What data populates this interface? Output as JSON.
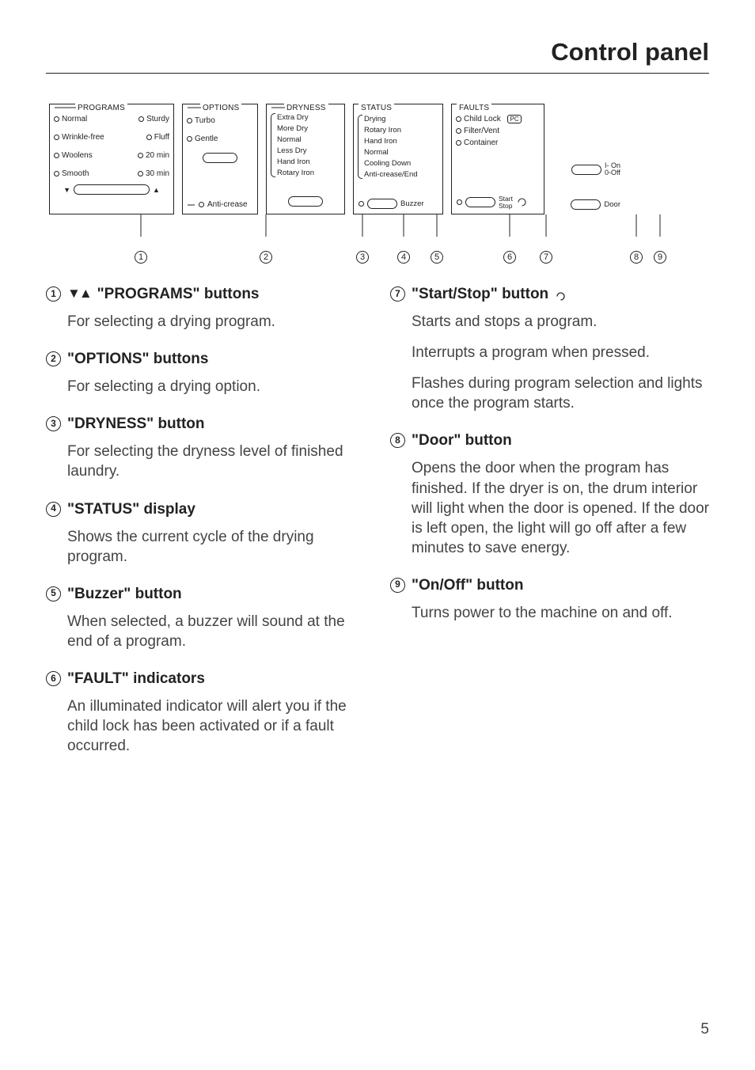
{
  "page_title": "Control panel",
  "page_number": "5",
  "panel": {
    "programs": {
      "header": "PROGRAMS",
      "options": [
        "Normal",
        "Sturdy",
        "Wrinkle-free",
        "Fluff",
        "Woolens",
        "20 min",
        "Smooth",
        "30 min"
      ]
    },
    "options": {
      "header": "OPTIONS",
      "items": [
        "Turbo",
        "Gentle"
      ],
      "anticrease": "Anti-crease"
    },
    "dryness": {
      "header": "DRYNESS",
      "items": [
        "Extra Dry",
        "More Dry",
        "Normal",
        "Less Dry",
        "Hand Iron",
        "Rotary Iron"
      ]
    },
    "status": {
      "header": "STATUS",
      "items": [
        "Drying",
        "Rotary Iron",
        "Hand Iron",
        "Normal",
        "Cooling Down",
        "Anti-crease/End"
      ]
    },
    "buzzer_label": "Buzzer",
    "faults": {
      "header": "FAULTS",
      "items": [
        "Child Lock",
        "Filter/Vent",
        "Container"
      ],
      "pc": "PC"
    },
    "startstop_label": "Start\nStop",
    "onoff": {
      "on": "I- On",
      "off": "0-Off"
    },
    "door_label": "Door"
  },
  "callout_labels": [
    "1",
    "2",
    "3",
    "4",
    "5",
    "6",
    "7",
    "8",
    "9"
  ],
  "descriptions": {
    "left": [
      {
        "num": "1",
        "title": "\"PROGRAMS\" buttons",
        "prefix_tri": true,
        "body": [
          "For selecting a drying program."
        ]
      },
      {
        "num": "2",
        "title": "\"OPTIONS\" buttons",
        "body": [
          "For selecting a drying option."
        ]
      },
      {
        "num": "3",
        "title": "\"DRYNESS\" button",
        "body": [
          "For selecting the dryness level of finished laundry."
        ]
      },
      {
        "num": "4",
        "title": "\"STATUS\" display",
        "body": [
          "Shows the current cycle of the drying program."
        ]
      },
      {
        "num": "5",
        "title": "\"Buzzer\" button",
        "body": [
          "When selected, a buzzer will sound at the end of a program."
        ]
      },
      {
        "num": "6",
        "title": "\"FAULT\" indicators",
        "body": [
          "An illuminated indicator will alert you if the child lock has been activated or if a fault occurred."
        ]
      }
    ],
    "right": [
      {
        "num": "7",
        "title": "\"Start/Stop\" button",
        "suffix_arc": true,
        "body": [
          "Starts and stops a program.",
          "Interrupts a program when pressed.",
          "Flashes during program selection and lights once the program starts."
        ]
      },
      {
        "num": "8",
        "title": "\"Door\" button",
        "body": [
          "Opens the door when the program has finished. If the dryer is on, the drum interior will light when the door is opened. If the door is left open, the light will go off after a few minutes to save energy."
        ]
      },
      {
        "num": "9",
        "title": "\"On/Off\" button",
        "body": [
          "Turns power to the machine on and off."
        ]
      }
    ]
  }
}
